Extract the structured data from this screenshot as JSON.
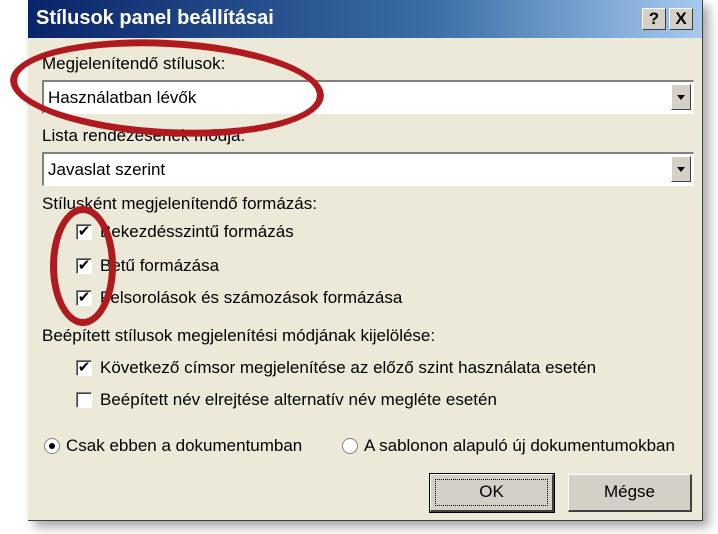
{
  "dialog": {
    "title": "Stílusok panel beállításai",
    "help_button": "?",
    "close_button": "X"
  },
  "display_styles": {
    "label": "Megjelenítendő stílusok:",
    "value": "Használatban lévők"
  },
  "sort_order": {
    "label": "Lista rendezésének módja:",
    "value": "Javaslat szerint"
  },
  "format_section": {
    "label": "Stílusként megjelenítendő formázás:",
    "items": [
      {
        "label": "Bekezdésszintű formázás",
        "checked": true
      },
      {
        "label": "Betű formázása",
        "checked": true
      },
      {
        "label": "Felsorolások és számozások formázása",
        "checked": true
      }
    ]
  },
  "builtin_section": {
    "label": "Beépített stílusok megjelenítési módjának kijelölése:",
    "items": [
      {
        "label": "Következő címsor megjelenítése az előző szint használata esetén",
        "checked": true
      },
      {
        "label": "Beépített név elrejtése alternatív név megléte esetén",
        "checked": false
      }
    ]
  },
  "scope": {
    "options": [
      {
        "label": "Csak ebben a dokumentumban",
        "selected": true
      },
      {
        "label": "A sablonon alapuló új dokumentumokban",
        "selected": false
      }
    ]
  },
  "buttons": {
    "ok": "OK",
    "cancel": "Mégse"
  },
  "colors": {
    "titlebar_start": "#0a246a",
    "titlebar_end": "#a6caf0",
    "dialog_bg": "#ece9d8",
    "annotation": "#b0191e"
  },
  "icons": {
    "help": "question-mark-icon",
    "close": "close-icon",
    "dropdown": "chevron-down-icon",
    "check": "checkmark-icon"
  }
}
